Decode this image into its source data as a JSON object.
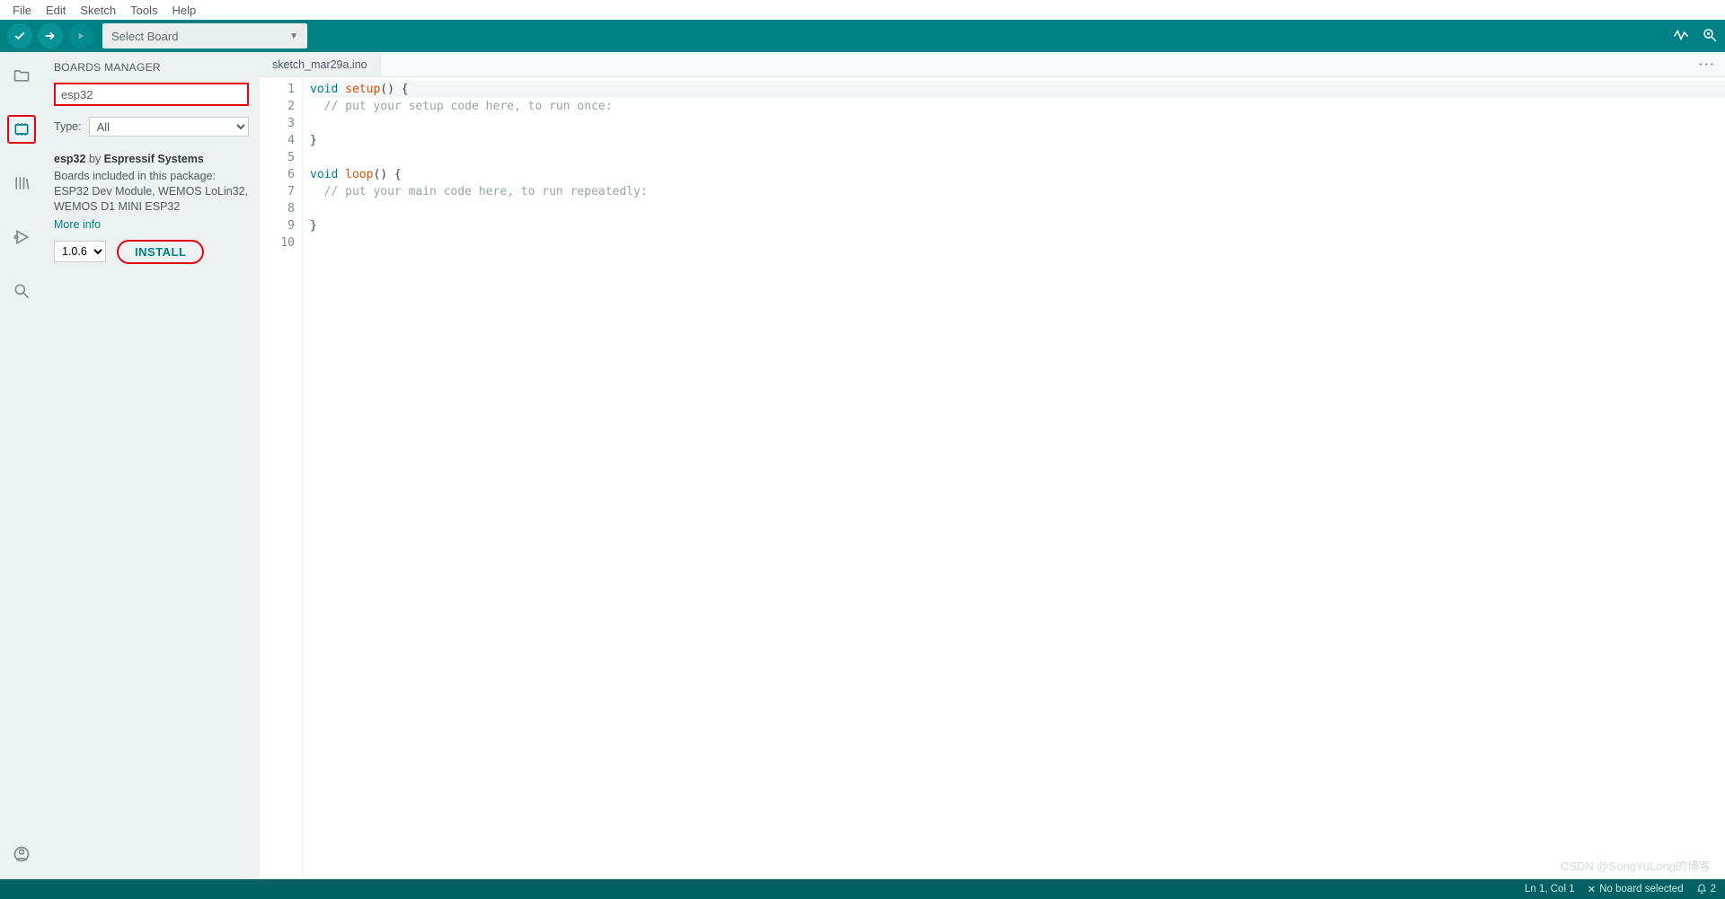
{
  "menu": {
    "items": [
      "File",
      "Edit",
      "Sketch",
      "Tools",
      "Help"
    ]
  },
  "toolbar": {
    "select_board": "Select Board"
  },
  "activity": {
    "icons": [
      "folder",
      "boards",
      "library",
      "debug",
      "search"
    ],
    "bottom_icon": "account"
  },
  "boards_manager": {
    "title": "BOARDS MANAGER",
    "search_value": "esp32",
    "type_label": "Type:",
    "type_options": [
      "All"
    ],
    "type_selected": "All",
    "package": {
      "name": "esp32",
      "by": "by",
      "vendor": "Espressif Systems",
      "included_label": "Boards included in this package:",
      "boards": "ESP32 Dev Module, WEMOS LoLin32, WEMOS D1 MINI ESP32",
      "more_info": "More info",
      "versions": [
        "1.0.6"
      ],
      "version_selected": "1.0.6",
      "install_label": "INSTALL"
    }
  },
  "editor": {
    "tab": "sketch_mar29a.ino",
    "line_numbers": [
      "1",
      "2",
      "3",
      "4",
      "5",
      "6",
      "7",
      "8",
      "9",
      "10"
    ],
    "lines": [
      {
        "kw": "void",
        "fn": "setup",
        "rest": "() {"
      },
      {
        "cm": "  // put your setup code here, to run once:"
      },
      {
        "plain": ""
      },
      {
        "plain": "}"
      },
      {
        "plain": ""
      },
      {
        "kw": "void",
        "fn": "loop",
        "rest": "() {"
      },
      {
        "cm": "  // put your main code here, to run repeatedly:"
      },
      {
        "plain": ""
      },
      {
        "plain": "}"
      },
      {
        "plain": ""
      }
    ]
  },
  "statusbar": {
    "position": "Ln 1, Col 1",
    "board": "No board selected",
    "notif_count": "2"
  },
  "watermark": "CSDN @SongYuLong的博客"
}
